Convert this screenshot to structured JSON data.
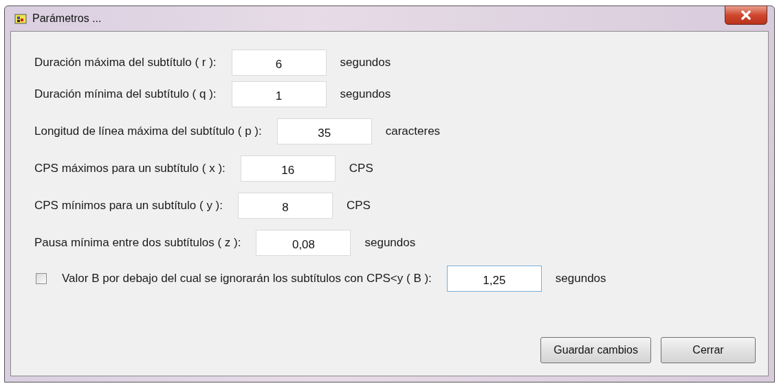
{
  "window": {
    "title": "Parámetros ..."
  },
  "rows": [
    {
      "kind": "field",
      "label": "Duración máxima del subtítulo ( r ):",
      "value": "6",
      "unit": "segundos",
      "focused": false
    },
    {
      "kind": "field",
      "label": "Duración mínima del subtítulo ( q ):",
      "value": "1",
      "unit": "segundos",
      "focused": false
    },
    {
      "kind": "field",
      "label": "Longitud de línea máxima del subtítulo ( p ):",
      "value": "35",
      "unit": "caracteres",
      "focused": false
    },
    {
      "kind": "field",
      "label": "CPS máximos para un subtítulo ( x ):",
      "value": "16",
      "unit": "CPS",
      "focused": false
    },
    {
      "kind": "field",
      "label": "CPS mínimos para un subtítulo ( y ):",
      "value": "8",
      "unit": "CPS",
      "focused": false
    },
    {
      "kind": "field",
      "label": "Pausa mínima entre dos subtítulos ( z ):",
      "value": "0,08",
      "unit": "segundos",
      "focused": false
    },
    {
      "kind": "checkfield",
      "checked": false,
      "label": "Valor B por debajo del cual se ignorarán los subtítulos con CPS<y ( B ):",
      "value": "1,25",
      "unit": "segundos",
      "focused": true
    }
  ],
  "buttons": [
    "Guardar cambios",
    "Cerrar"
  ]
}
